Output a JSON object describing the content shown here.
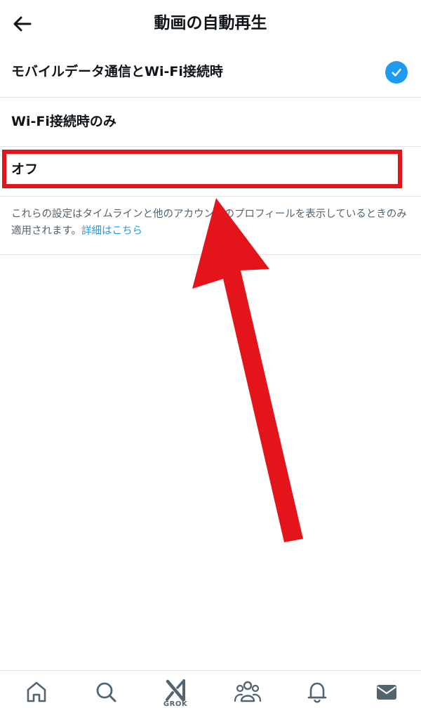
{
  "header": {
    "title": "動画の自動再生",
    "back_icon": "arrow-left-icon"
  },
  "options": [
    {
      "label": "モバイルデータ通信とWi-Fi接続時",
      "selected": true
    },
    {
      "label": "Wi-Fi接続時のみ",
      "selected": false
    },
    {
      "label": "オフ",
      "selected": false
    }
  ],
  "note": {
    "text": "これらの設定はタイムラインと他のアカウントのプロフィールを表示しているときのみ適用されます。",
    "link": "詳細はこちら"
  },
  "tabbar": {
    "tabs": [
      {
        "name": "home",
        "icon": "home-icon"
      },
      {
        "name": "search",
        "icon": "search-icon"
      },
      {
        "name": "grok",
        "icon": "grok-icon",
        "caption": "GROK"
      },
      {
        "name": "communities",
        "icon": "communities-icon"
      },
      {
        "name": "notifications",
        "icon": "bell-icon"
      },
      {
        "name": "messages",
        "icon": "envelope-icon"
      }
    ]
  },
  "colors": {
    "accent": "#1d9bf0",
    "annotation": "#e3151a",
    "text": "#0f1419",
    "secondary_text": "#536471",
    "divider": "#e1e4e8"
  }
}
